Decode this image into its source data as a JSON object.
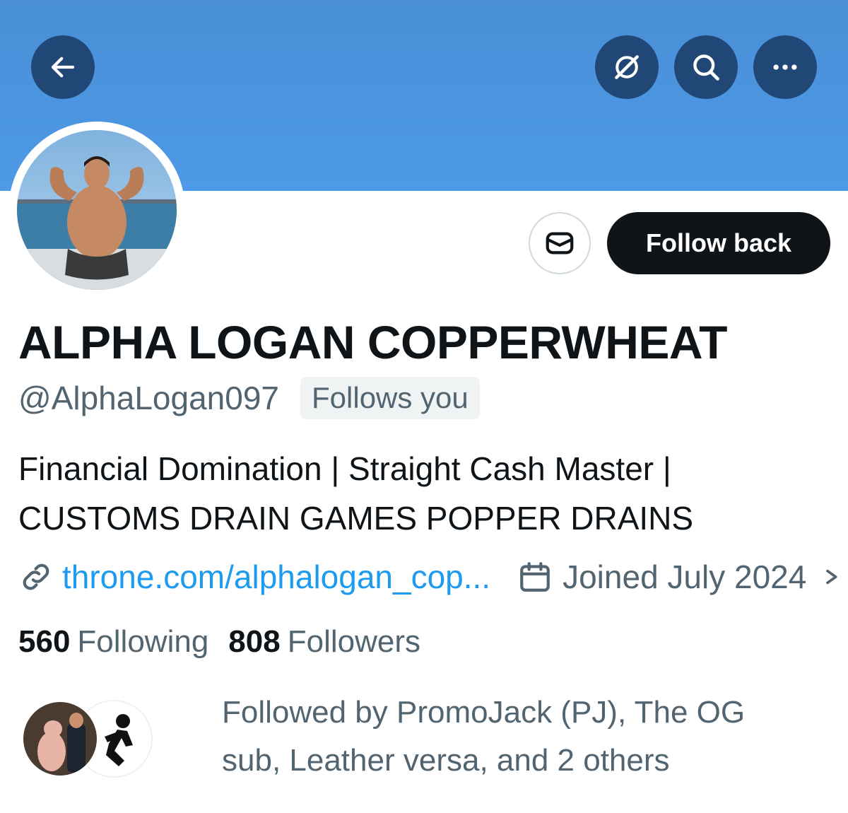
{
  "header": {
    "back_icon": "arrow-left-icon",
    "grok_icon": "grok-icon",
    "search_icon": "search-icon",
    "more_icon": "more-dots-icon",
    "banner_color": "#4b95e0"
  },
  "profile": {
    "display_name": "ALPHA LOGAN COPPERWHEAT",
    "handle": "@AlphaLogan097",
    "follows_you_badge": "Follows you",
    "follow_button_label": "Follow back",
    "message_icon": "envelope-icon",
    "bio_lines": [
      "Financial Domination | Straight Cash Master |",
      "CUSTOMS DRAIN GAMES POPPER DRAINS"
    ],
    "link": "throne.com/alphalogan_cop...",
    "joined": "Joined July 2024",
    "following_count": "560",
    "following_label": "Following",
    "followers_count": "808",
    "followers_label": "Followers",
    "followed_by_lines": [
      "Followed by PromoJack (PJ), The OG",
      "sub, Leather versa, and 2 others"
    ]
  },
  "colors": {
    "link": "#1d9bf0",
    "secondary_text": "#536471",
    "primary_text": "#0f1419"
  }
}
